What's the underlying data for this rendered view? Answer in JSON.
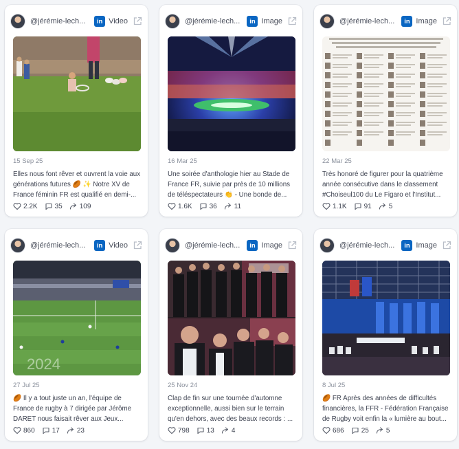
{
  "posts": [
    {
      "handle": "@jérémie-lech...",
      "platform": "linkedin",
      "type": "Video",
      "date": "15 Sep 25",
      "text": "Elles nous font rêver et ouvrent la voie aux générations futures 🏉 ✨ Notre XV de France féminin FR est qualifié en demi-...",
      "likes": "2.2K",
      "comments": "35",
      "shares": "109"
    },
    {
      "handle": "@jérémie-lech...",
      "platform": "linkedin",
      "type": "Image",
      "date": "16 Mar 25",
      "text": "Une soirée d'anthologie hier au Stade de France FR, suivie par près de 10 millions de téléspectateurs 👏 - Une bonde de...",
      "likes": "1.6K",
      "comments": "36",
      "shares": "11"
    },
    {
      "handle": "@jérémie-lech...",
      "platform": "linkedin",
      "type": "Image",
      "date": "22 Mar 25",
      "text": "Très honoré de figurer pour la quatrième année consécutive dans le classement #Choiseul100 du Le Figaro et l'Institut...",
      "likes": "1.1K",
      "comments": "91",
      "shares": "5"
    },
    {
      "handle": "@jérémie-lech...",
      "platform": "linkedin",
      "type": "Video",
      "date": "27 Jul 25",
      "text": "🏉 Il y a tout juste un an, l'équipe de France de rugby à 7 dirigée par Jérôme DARET nous faisait rêver aux Jeux...",
      "likes": "860",
      "comments": "17",
      "shares": "23"
    },
    {
      "handle": "@jérémie-lech...",
      "platform": "linkedin",
      "type": "Image",
      "date": "25 Nov 24",
      "text": "Clap de fin sur une tournée d'automne exceptionnelle, aussi bien sur le terrain qu'en dehors, avec des beaux records : ...",
      "likes": "798",
      "comments": "13",
      "shares": "4"
    },
    {
      "handle": "@jérémie-lech...",
      "platform": "linkedin",
      "type": "Image",
      "date": "8 Jul 25",
      "text": "🏉 FR Après des années de difficultés financières, la FFR - Fédération Française de Rugby voit enfin la « lumière au bout...",
      "likes": "686",
      "comments": "25",
      "shares": "5"
    }
  ],
  "colors": {
    "linkedin": "#0a66c2",
    "card_bg": "#ffffff",
    "page_bg": "#f3f5f8"
  },
  "icons": {
    "platform": "linkedin-icon",
    "external": "external-link-icon",
    "like": "heart-icon",
    "comment": "comment-icon",
    "share": "share-icon"
  }
}
